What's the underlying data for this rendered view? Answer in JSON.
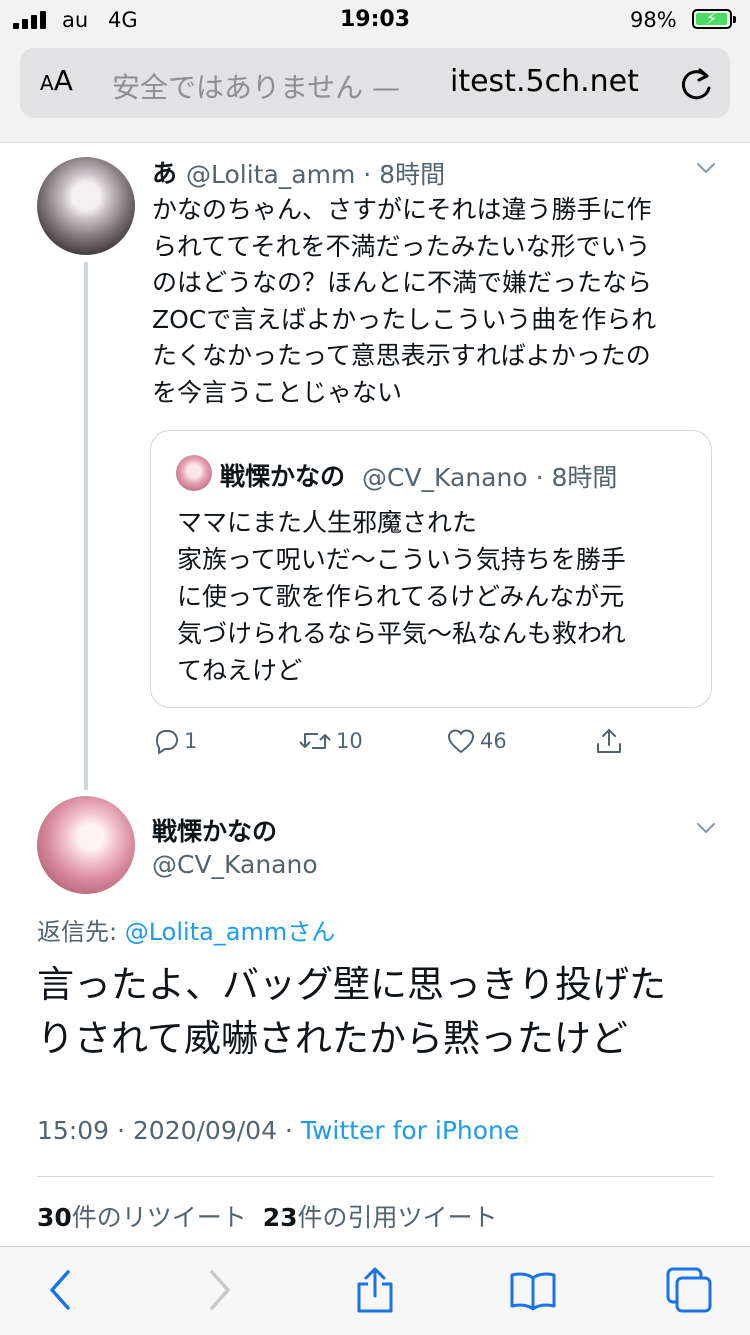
{
  "status_bar": {
    "carrier": "au",
    "network": "4G",
    "time": "19:03",
    "battery_percent": "98%",
    "battery_level": 0.98
  },
  "address_bar": {
    "text_size_label": "AA",
    "security_text": "安全ではありません —",
    "domain": "itest.5ch.net",
    "reload_icon": "reload-icon"
  },
  "tweet1": {
    "name": "あ",
    "handle_time": "@Lolita_amm · 8時間",
    "lines": [
      "かなのちゃん、さすがにそれは違う勝手に作",
      "られててそれを不満だったみたいな形でいう",
      "のはどうなの？ほんとに不満で嫌だったなら",
      "ZOCで言えばよかったしこういう曲を作られ",
      "たくなかったって意思表示すればよかったの",
      "を今言うことじゃない"
    ],
    "quote": {
      "name": "戦慄かなの",
      "handle_time": "@CV_Kanano · 8時間",
      "lines": [
        "ママにまた人生邪魔された",
        "家族って呪いだ〜こういう気持ちを勝手",
        "に使って歌を作られてるけどみんなが元",
        "気づけられるなら平気〜私なんも救われ",
        "てねえけど"
      ]
    },
    "actions": {
      "reply_count": "1",
      "retweet_count": "10",
      "like_count": "46"
    }
  },
  "tweet2": {
    "name": "戦慄かなの",
    "handle": "@CV_Kanano",
    "reply_prefix": "返信先: ",
    "reply_link": "@Lolita_amm",
    "reply_suffix": "さん",
    "lines": [
      "言ったよ、バッグ壁に思っきり投げた",
      "りされて威嚇されたから黙ったけど"
    ],
    "timestamp": "15:09 · 2020/09/04 · ",
    "source": "Twitter for iPhone",
    "retweets_num": "30",
    "retweets_label": "件のリツイート",
    "quotes_num": "23",
    "quotes_label": "件の引用ツイート"
  },
  "toolbar": {
    "icons": [
      "back-icon",
      "forward-icon",
      "share-icon",
      "bookmarks-icon",
      "tabs-icon"
    ]
  },
  "colors": {
    "link": "#1d9bf0",
    "secondary_text": "#536471",
    "battery_green": "#4cd964"
  }
}
